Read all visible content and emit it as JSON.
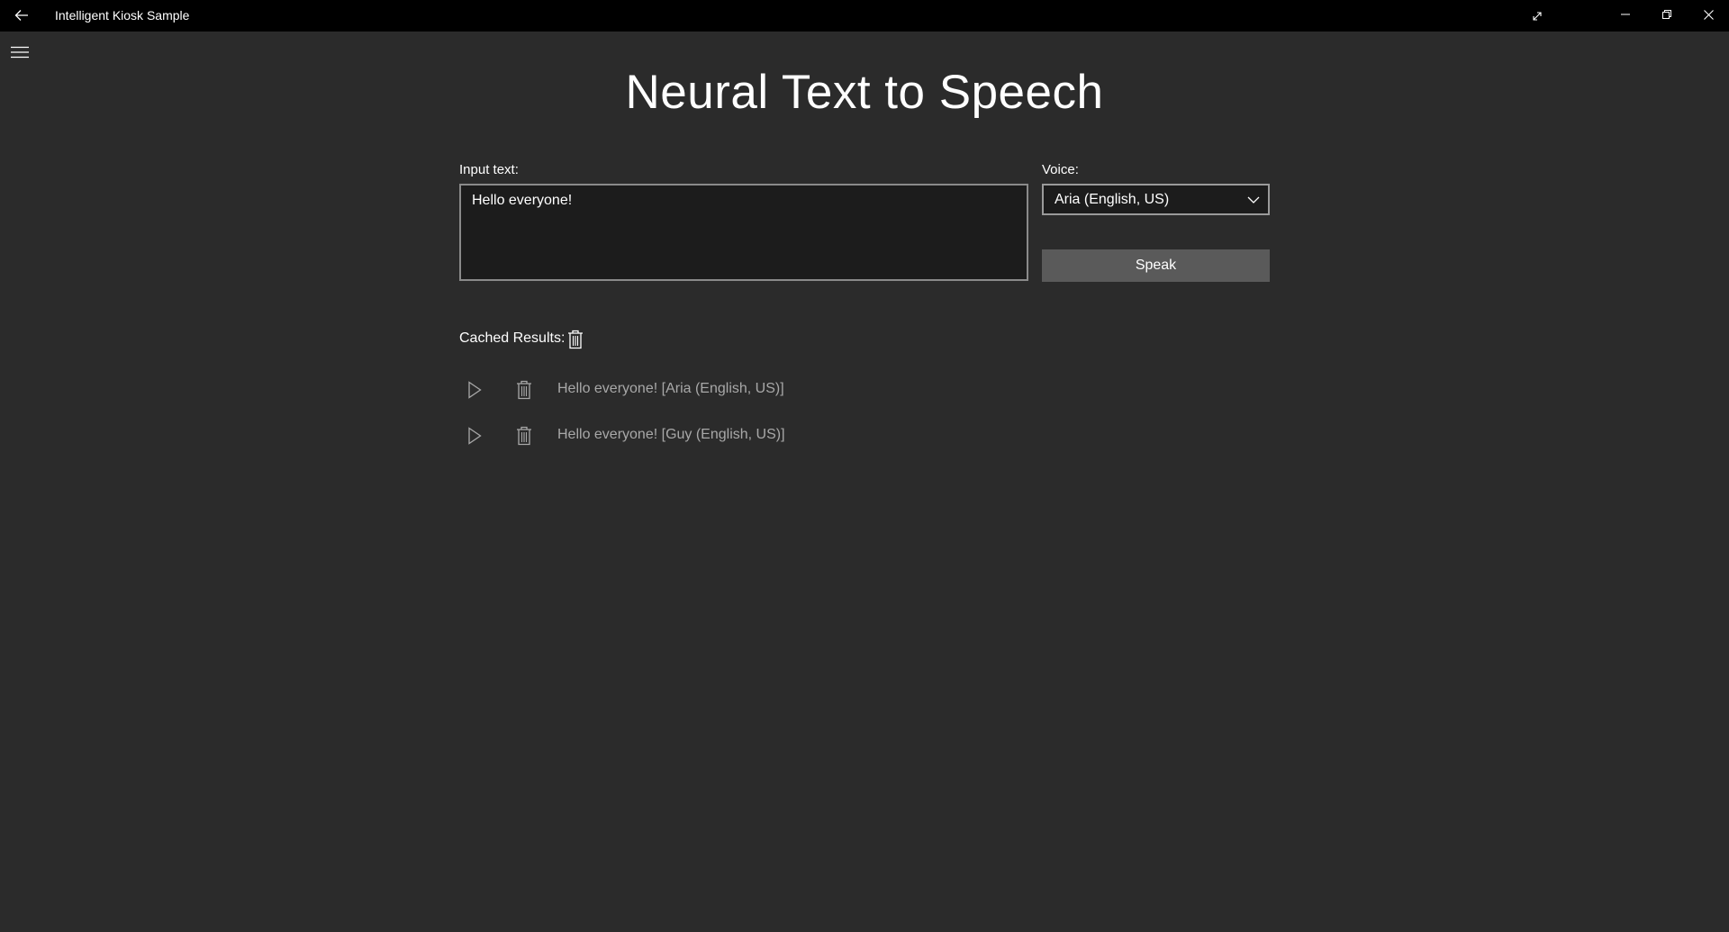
{
  "window": {
    "title": "Intelligent Kiosk Sample"
  },
  "page": {
    "title": "Neural Text to Speech"
  },
  "input": {
    "label": "Input text:",
    "value": "Hello everyone!"
  },
  "voice": {
    "label": "Voice:",
    "selected": "Aria (English, US)"
  },
  "speak_button": {
    "label": "Speak"
  },
  "cached": {
    "label": "Cached Results:",
    "items": [
      {
        "text": "Hello everyone! [Aria (English, US)]"
      },
      {
        "text": "Hello everyone! [Guy (English, US)]"
      }
    ]
  },
  "icons": {
    "back": "back-arrow-icon",
    "menu": "hamburger-menu-icon",
    "expand": "expand-icon",
    "minimize": "minimize-icon",
    "maximize": "restore-icon",
    "close": "close-icon",
    "trash": "trash-icon",
    "play": "play-icon",
    "chevron": "chevron-down-icon"
  },
  "colors": {
    "background": "#2b2b2b",
    "titlebar": "#000000",
    "input_background": "#1c1c1c",
    "button": "#5a5a5a",
    "muted_text": "#a8a8a8"
  }
}
